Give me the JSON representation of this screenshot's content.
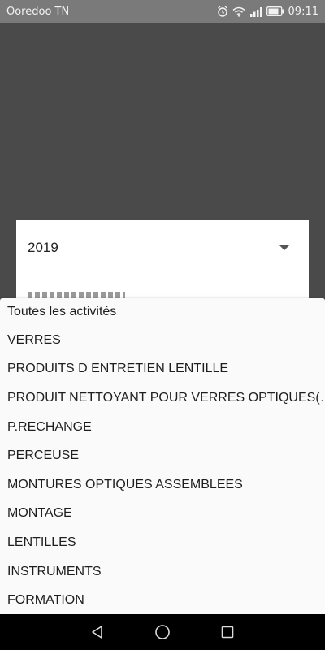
{
  "status_bar": {
    "carrier": "Ooredoo TN",
    "time": "09:11",
    "icons": [
      "alarm-icon",
      "wifi-icon",
      "signal-icon",
      "battery-icon"
    ]
  },
  "spinner": {
    "selected_value": "2019",
    "icon": "dropdown-arrow-icon"
  },
  "dropdown": {
    "items": [
      "Toutes les activités",
      "VERRES",
      "PRODUITS D ENTRETIEN LENTILLE",
      "PRODUIT NETTOYANT POUR  VERRES OPTIQUES(…",
      "P.RECHANGE",
      "PERCEUSE",
      "MONTURES OPTIQUES ASSEMBLEES",
      "MONTAGE",
      "LENTILLES",
      "INSTRUMENTS",
      "FORMATION"
    ]
  },
  "nav_bar": {
    "icons": [
      "back-icon",
      "home-icon",
      "recents-icon"
    ]
  },
  "colors": {
    "status_bar": "#7a7a7a",
    "scrim": "#4a4a4a",
    "dropdown_bg": "#fafafa",
    "nav_bar": "#000000"
  }
}
